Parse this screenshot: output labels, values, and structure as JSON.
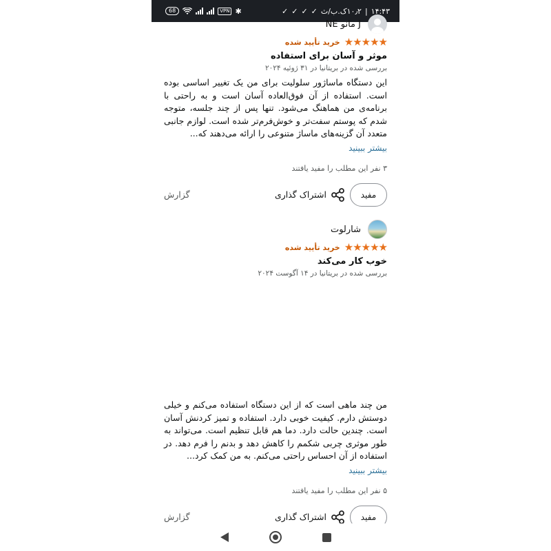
{
  "status_bar": {
    "time": "۱۴:۴۳",
    "carrier_text": "۱۰٫۲ک.ب/ث",
    "battery": "68",
    "vpn": "VPN"
  },
  "reviews": [
    {
      "reviewer_name": "J مانو NE",
      "verified": "خرید تأیید شده",
      "stars": "★★★★★",
      "rating": 5,
      "title": "موثر و آسان برای استفاده",
      "meta": "بررسی شده در بریتانیا در ۳۱ ژوئیه ۲۰۲۴",
      "body": "این دستگاه ماساژور سلولیت برای من یک تغییر اساسی بوده است. استفاده از آن فوق‌العاده آسان است و به راحتی با برنامه‌ی من هماهنگ می‌شود. تنها پس از چند جلسه، متوجه شدم که پوستم سفت‌تر و خوش‌فرم‌تر شده است. لوازم جانبی متعدد آن گزینه‌های ماساژ متنوعی را ارائه می‌دهند که...",
      "more": "بیشتر ببینید",
      "helpful_count": "۳ نفر این مطلب را مفید یافتند",
      "helpful_button": "مفید",
      "share": "اشتراک گذاری",
      "report": "گزارش"
    },
    {
      "reviewer_name": "شارلوت",
      "verified": "خرید تأیید شده",
      "stars": "★★★★★",
      "rating": 5,
      "title": "خوب کار می‌کند",
      "meta": "بررسی شده در بریتانیا در ۱۴ آگوست ۲۰۲۴",
      "body": "من چند ماهی است که از این دستگاه استفاده می‌کنم و خیلی دوستش دارم. کیفیت خوبی دارد. استفاده و تمیز کردنش آسان است. چندین حالت دارد. دما هم قابل تنظیم است. می‌تواند به طور موثری چربی شکمم را کاهش دهد و بدنم را فرم دهد. در استفاده از آن احساس راحتی می‌کنم. به من کمک کرد...",
      "more": "بیشتر ببینید",
      "helpful_count": "۵ نفر این مطلب را مفید یافتند",
      "helpful_button": "مفید",
      "share": "اشتراک گذاری",
      "report": "گزارش"
    }
  ],
  "colors": {
    "star": "#e7711b",
    "verified": "#c45500",
    "link": "#2a6f97",
    "status_bar": "#1c1f24"
  },
  "icons": {
    "share": "share-icon",
    "back": "back-icon",
    "home": "home-icon",
    "recent": "recent-apps-icon"
  }
}
